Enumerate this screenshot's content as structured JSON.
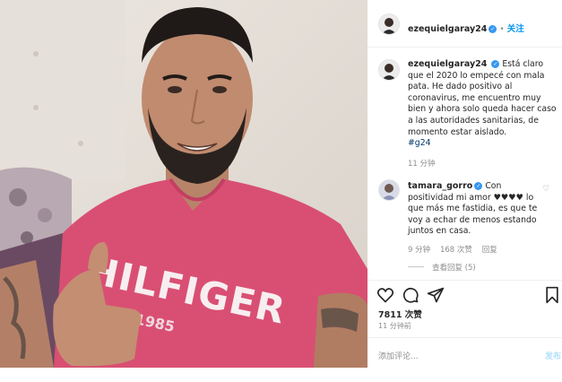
{
  "post": {
    "username": "ezequielgaray24",
    "verified_mark": "✓",
    "follow_label": "关注",
    "separator": "•",
    "caption": "Está claro que el 2020 lo empecé con mala pata. He dado positivo al coronavirus, me encuentro muy bien y ahora solo queda hacer caso a las autoridades sanitarias, de momento estar aislado.",
    "hashtag": "#g24",
    "caption_time": "11 分钟",
    "likes": "7811 次赞",
    "posted_ago": "11 分钟前",
    "comment_placeholder": "添加评论...",
    "post_button": "发布"
  },
  "comment": {
    "username": "tamara_gorro",
    "verified_mark": "✓",
    "text": "Con positividad mi amor ♥♥♥♥ lo que más me fastidia, es que te voy a echar de menos estando juntos en casa.",
    "time": "9 分钟",
    "likes": "168 次赞",
    "reply_label": "回复",
    "view_replies": "查看回复 (5)"
  },
  "photo": {
    "shirt_text": "HILFIGER",
    "shirt_subtext": "NY 1985",
    "shirt_color": "#d94f73"
  },
  "icons": [
    "heart-icon",
    "comment-icon",
    "share-icon",
    "bookmark-icon"
  ],
  "colors": {
    "link": "#0095f6",
    "verified": "#3897f0",
    "hashtag": "#00376b"
  }
}
